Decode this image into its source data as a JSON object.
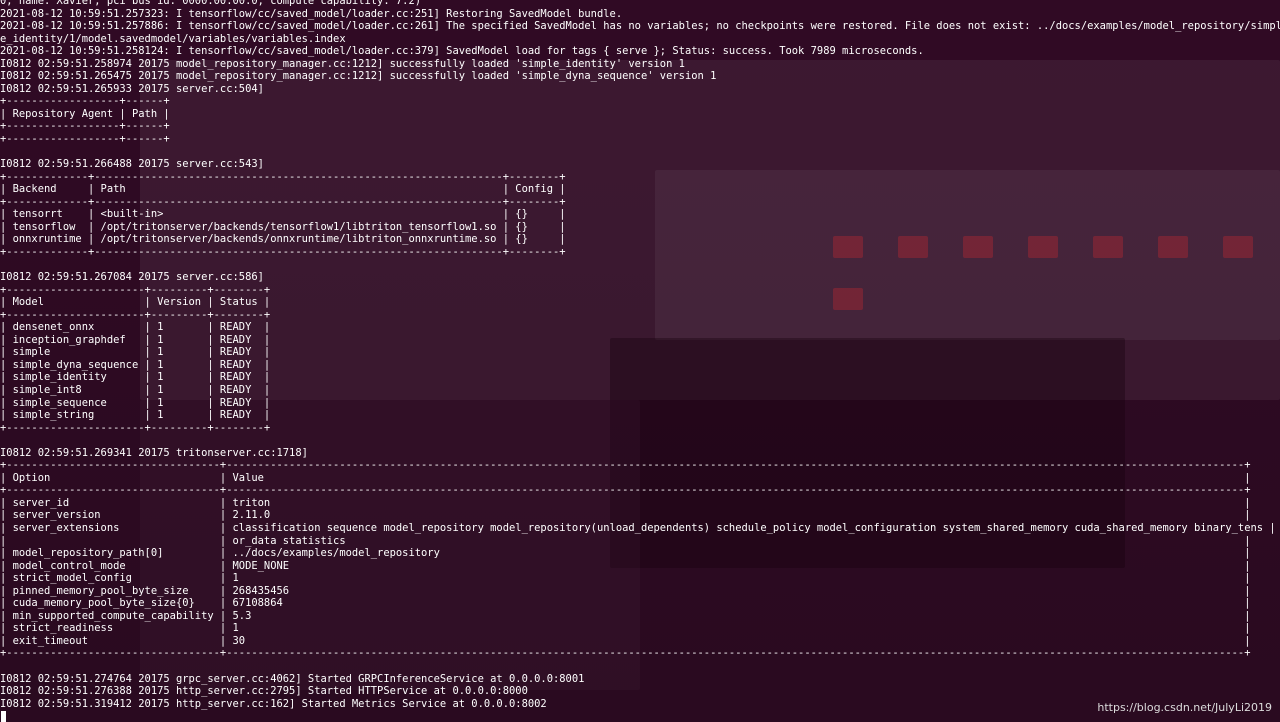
{
  "terminal": {
    "lines": [
      "0, name: Xavier, pci bus id: 0000:00:00.0, compute capability: 7.2)",
      "2021-08-12 10:59:51.257323: I tensorflow/cc/saved_model/loader.cc:251] Restoring SavedModel bundle.",
      "2021-08-12 10:59:51.257886: I tensorflow/cc/saved_model/loader.cc:261] The specified SavedModel has no variables; no checkpoints were restored. File does not exist: ../docs/examples/model_repository/simpl",
      "e_identity/1/model.savedmodel/variables/variables.index",
      "2021-08-12 10:59:51.258124: I tensorflow/cc/saved_model/loader.cc:379] SavedModel load for tags { serve }; Status: success. Took 7989 microseconds.",
      "I0812 02:59:51.258974 20175 model_repository_manager.cc:1212] successfully loaded 'simple_identity' version 1",
      "I0812 02:59:51.265475 20175 model_repository_manager.cc:1212] successfully loaded 'simple_dyna_sequence' version 1",
      "I0812 02:59:51.265933 20175 server.cc:504]",
      "+------------------+------+",
      "| Repository Agent | Path |",
      "+------------------+------+",
      "+------------------+------+",
      "",
      "I0812 02:59:51.266488 20175 server.cc:543]",
      "+-------------+-----------------------------------------------------------------+--------+",
      "| Backend     | Path                                                            | Config |",
      "+-------------+-----------------------------------------------------------------+--------+",
      "| tensorrt    | <built-in>                                                      | {}     |",
      "| tensorflow  | /opt/tritonserver/backends/tensorflow1/libtriton_tensorflow1.so | {}     |",
      "| onnxruntime | /opt/tritonserver/backends/onnxruntime/libtriton_onnxruntime.so | {}     |",
      "+-------------+-----------------------------------------------------------------+--------+",
      "",
      "I0812 02:59:51.267084 20175 server.cc:586]",
      "+----------------------+---------+--------+",
      "| Model                | Version | Status |",
      "+----------------------+---------+--------+",
      "| densenet_onnx        | 1       | READY  |",
      "| inception_graphdef   | 1       | READY  |",
      "| simple               | 1       | READY  |",
      "| simple_dyna_sequence | 1       | READY  |",
      "| simple_identity      | 1       | READY  |",
      "| simple_int8          | 1       | READY  |",
      "| simple_sequence      | 1       | READY  |",
      "| simple_string        | 1       | READY  |",
      "+----------------------+---------+--------+",
      "",
      "I0812 02:59:51.269341 20175 tritonserver.cc:1718]",
      "+----------------------------------+------------------------------------------------------------------------------------------------------------------------------------------------------------------+",
      "| Option                           | Value                                                                                                                                                            |",
      "+----------------------------------+------------------------------------------------------------------------------------------------------------------------------------------------------------------+",
      "| server_id                        | triton                                                                                                                                                           |",
      "| server_version                   | 2.11.0                                                                                                                                                           |",
      "| server_extensions                | classification sequence model_repository model_repository(unload_dependents) schedule_policy model_configuration system_shared_memory cuda_shared_memory binary_tens |",
      "|                                  | or_data statistics                                                                                                                                               |",
      "| model_repository_path[0]         | ../docs/examples/model_repository                                                                                                                                |",
      "| model_control_mode               | MODE_NONE                                                                                                                                                        |",
      "| strict_model_config              | 1                                                                                                                                                                |",
      "| pinned_memory_pool_byte_size     | 268435456                                                                                                                                                        |",
      "| cuda_memory_pool_byte_size{0}    | 67108864                                                                                                                                                         |",
      "| min_supported_compute_capability | 5.3                                                                                                                                                              |",
      "| strict_readiness                 | 1                                                                                                                                                                |",
      "| exit_timeout                     | 30                                                                                                                                                               |",
      "+----------------------------------+------------------------------------------------------------------------------------------------------------------------------------------------------------------+",
      "",
      "I0812 02:59:51.274764 20175 grpc_server.cc:4062] Started GRPCInferenceService at 0.0.0.0:8001",
      "I0812 02:59:51.276388 20175 http_server.cc:2795] Started HTTPService at 0.0.0.0:8000",
      "I0812 02:59:51.319412 20175 http_server.cc:162] Started Metrics Service at 0.0.0.0:8002"
    ]
  },
  "watermark": {
    "text": "https://blog.csdn.net/JulyLi2019"
  },
  "colors": {
    "background": "#300a24",
    "foreground": "#ffffff"
  }
}
